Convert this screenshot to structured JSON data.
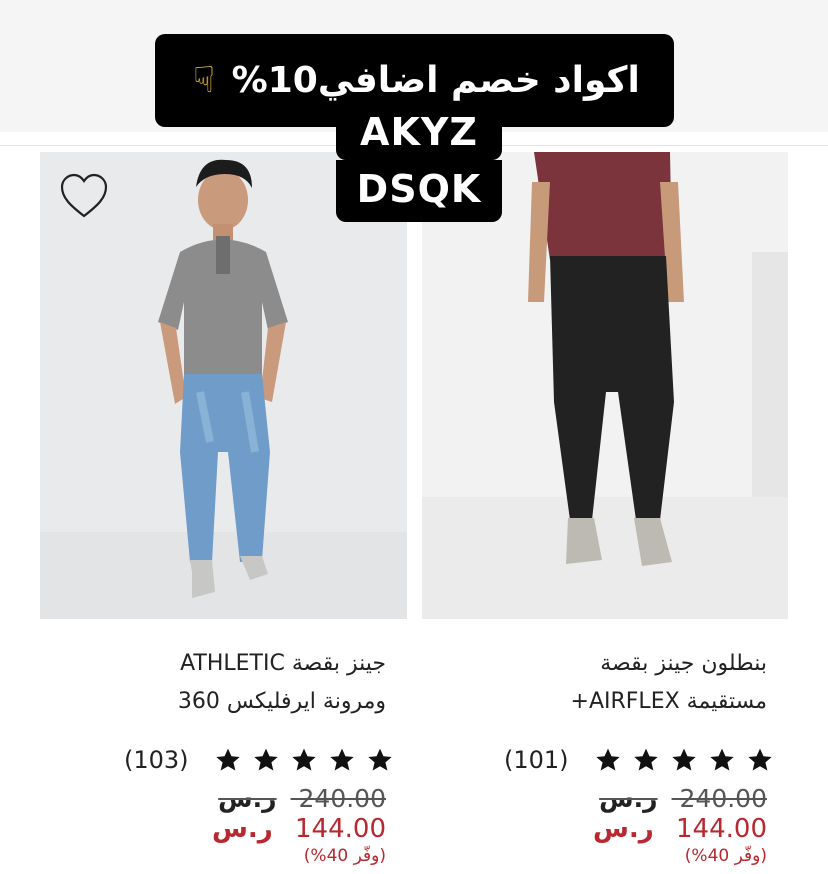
{
  "promo": {
    "title": "اكواد خصم اضافي10%",
    "code1": "AKYZ",
    "code2": "DSQK"
  },
  "products": [
    {
      "title_line1": "جينز بقصة ATHLETIC",
      "title_line2": "ومرونة ايرفليكس 360",
      "rating": 5,
      "review_count": "(103)",
      "old_price": "240.00",
      "new_price": "144.00",
      "currency": "ر.س",
      "savings": "(وفّر 40%)"
    },
    {
      "title_line1": "بنطلون جينز بقصة",
      "title_line2": "مستقيمة AIRFLEX+",
      "rating": 5,
      "review_count": "(101)",
      "old_price": "240.00",
      "new_price": "144.00",
      "currency": "ر.س",
      "savings": "(وفّر 40%)"
    }
  ],
  "icons": {
    "wishlist": "heart-outline-icon",
    "promo_hand": "pointing-down-hand-icon",
    "rating": "star-icon"
  },
  "colors": {
    "sale_price": "#b8282e",
    "promo_background": "#000000",
    "promo_text": "#ffffff"
  }
}
